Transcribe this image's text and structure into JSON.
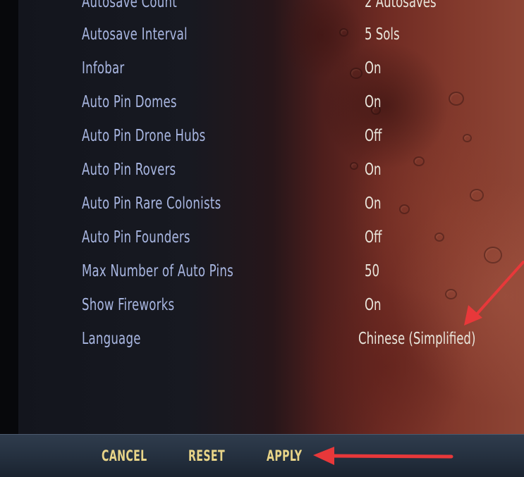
{
  "settings": [
    {
      "label": "Autosave Count",
      "value": "2 Autosaves"
    },
    {
      "label": "Autosave Interval",
      "value": "5 Sols"
    },
    {
      "label": "Infobar",
      "value": "On"
    },
    {
      "label": "Auto Pin Domes",
      "value": "On"
    },
    {
      "label": "Auto Pin Drone Hubs",
      "value": "Off"
    },
    {
      "label": "Auto Pin Rovers",
      "value": "On"
    },
    {
      "label": "Auto Pin Rare Colonists",
      "value": "On"
    },
    {
      "label": "Auto Pin Founders",
      "value": "Off"
    },
    {
      "label": "Max Number of Auto Pins",
      "value": "50"
    },
    {
      "label": "Show Fireworks",
      "value": "On"
    },
    {
      "label": "Language",
      "value": "Chinese (Simplified)"
    }
  ],
  "buttons": {
    "cancel": "CANCEL",
    "reset": "RESET",
    "apply": "APPLY"
  },
  "colors": {
    "label": "#a9b7e2",
    "value": "#e9e6dc",
    "button": "#e8d488",
    "annotation_arrow": "#e8383a"
  }
}
